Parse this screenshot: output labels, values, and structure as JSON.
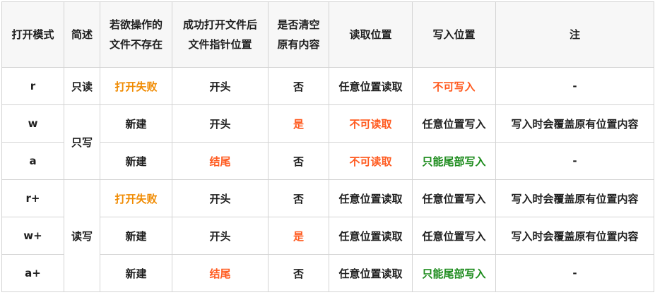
{
  "colors": {
    "text": "#1f1f1f",
    "border": "#d4d4d4",
    "header_bg": "#f7f7f7",
    "orange": "#f08a00",
    "red_orange": "#ff5a1f",
    "green": "#1a8a1a"
  },
  "header": {
    "mode": "打开模式",
    "desc": "简述",
    "missing_line1": "若欲操作的",
    "missing_line2": "文件不存在",
    "pointer_line1": "成功打开文件后",
    "pointer_line2": "文件指针位置",
    "clear_line1": "是否清空",
    "clear_line2": "原有内容",
    "read_pos": "读取位置",
    "write_pos": "写入位置",
    "note": "注"
  },
  "groups": {
    "read_only": "只读",
    "write_only": "只写",
    "read_write": "读写"
  },
  "rows": [
    {
      "mode": "r",
      "missing": "打开失败",
      "pointer": "开头",
      "clear": "否",
      "read": "任意位置读取",
      "write": "不可写入",
      "note": "-"
    },
    {
      "mode": "w",
      "missing": "新建",
      "pointer": "开头",
      "clear": "是",
      "read": "不可读取",
      "write": "任意位置写入",
      "note": "写入时会覆盖原有位置内容"
    },
    {
      "mode": "a",
      "missing": "新建",
      "pointer": "结尾",
      "clear": "否",
      "read": "不可读取",
      "write": "只能尾部写入",
      "note": "-"
    },
    {
      "mode": "r+",
      "missing": "打开失败",
      "pointer": "开头",
      "clear": "否",
      "read": "任意位置读取",
      "write": "任意位置写入",
      "note": "写入时会覆盖原有位置内容"
    },
    {
      "mode": "w+",
      "missing": "新建",
      "pointer": "开头",
      "clear": "是",
      "read": "任意位置读取",
      "write": "任意位置写入",
      "note": "写入时会覆盖原有位置内容"
    },
    {
      "mode": "a+",
      "missing": "新建",
      "pointer": "结尾",
      "clear": "否",
      "read": "任意位置读取",
      "write": "只能尾部写入",
      "note": "-"
    }
  ]
}
